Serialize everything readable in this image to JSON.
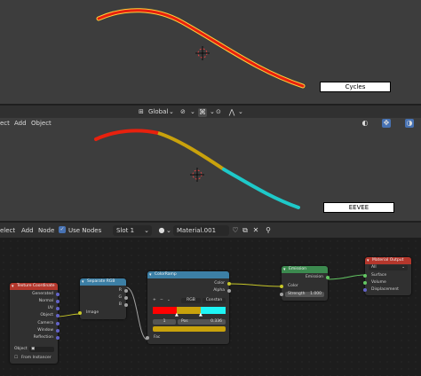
{
  "top_render": {
    "label": "Cycles"
  },
  "mid_header": {
    "transform_orientation": "Global",
    "menu": [
      "ect",
      "Add",
      "Object"
    ]
  },
  "mid_render": {
    "label": "EEVEE"
  },
  "node_header": {
    "menu": [
      "elect",
      "Add",
      "Node"
    ],
    "use_nodes_label": "Use Nodes",
    "slot": "Slot 1",
    "material": "Material.001"
  },
  "nodes": {
    "texcoord": {
      "title": "Texture Coordinate",
      "outputs": [
        "Generated",
        "Normal",
        "UV",
        "Object",
        "Camera",
        "Window",
        "Reflection"
      ],
      "object_label": "Object",
      "from_instancer": "From Instancer"
    },
    "separate": {
      "title": "Separate RGB",
      "outputs": [
        "R",
        "G",
        "B"
      ],
      "input": "Image"
    },
    "colorramp": {
      "title": "ColorRamp",
      "outputs": [
        "Color",
        "Alpha"
      ],
      "mode": "RGB",
      "interp": "Constan",
      "pos_index": "1",
      "pos_label": "Pos",
      "pos_value": "0.336",
      "fac_label": "Fac"
    },
    "emission": {
      "title": "Emission",
      "output": "Emission",
      "input_color": "Color",
      "strength_label": "Strength",
      "strength_value": "1.000"
    },
    "output": {
      "title": "Material Output",
      "target": "All",
      "inputs": [
        "Surface",
        "Volume",
        "Displacement"
      ]
    }
  },
  "colors": {
    "red_stroke": "#e8210e",
    "yellow_stroke": "#c9a20c",
    "cyan_stroke": "#1ec9c9",
    "texcoord_head": "#b4372c",
    "separate_head": "#3c7fa5",
    "ramp_head": "#3c7fa5",
    "emission_head": "#3c8a4f",
    "output_head": "#b4372c"
  }
}
